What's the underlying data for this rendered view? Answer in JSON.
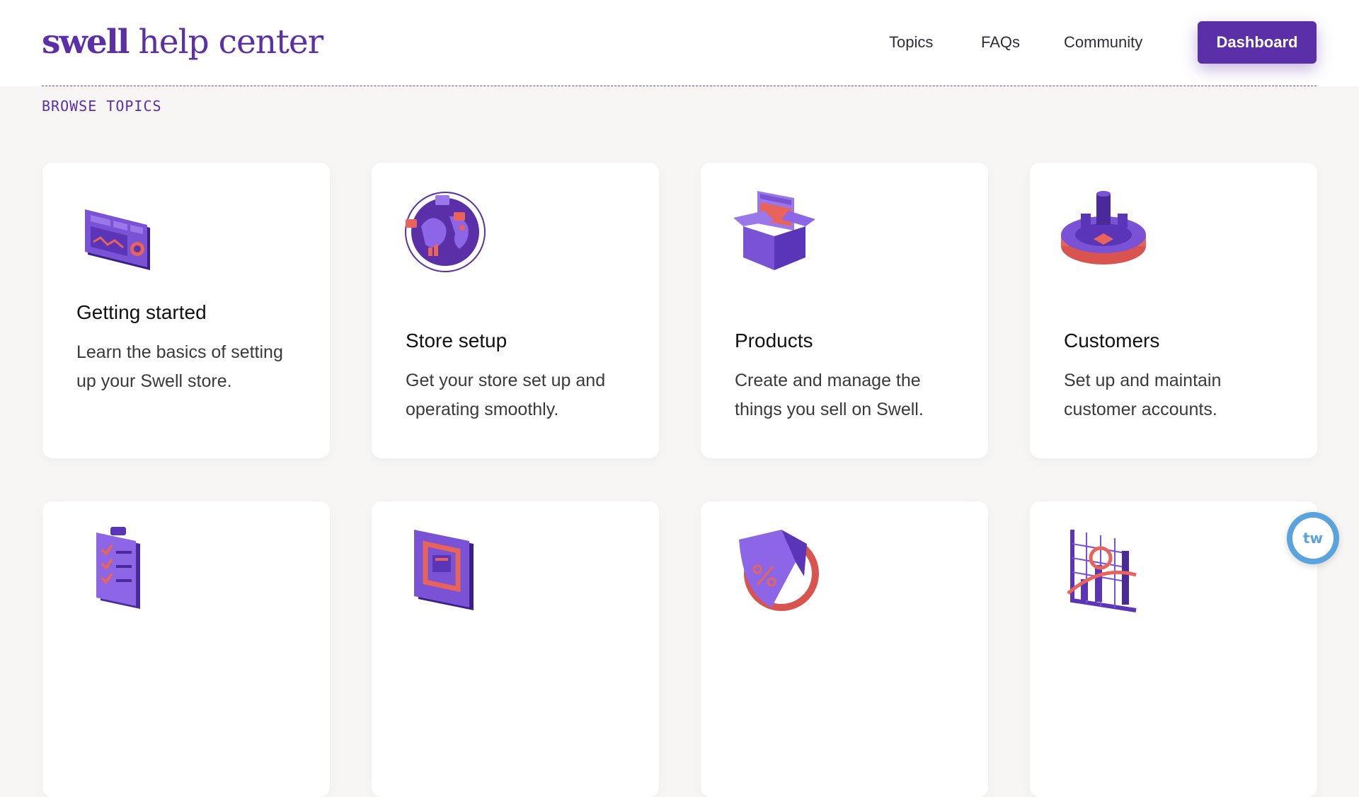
{
  "header": {
    "logo_brand": "swell",
    "logo_rest": " help center",
    "nav": [
      "Topics",
      "FAQs",
      "Community"
    ],
    "dashboard_label": "Dashboard"
  },
  "section_label": "BROWSE TOPICS",
  "cards": [
    {
      "title": "Getting started",
      "desc": "Learn the basics of setting up your Swell store.",
      "icon": "dashboard-screen-icon"
    },
    {
      "title": "Store setup",
      "desc": "Get your store set up and operating smoothly.",
      "icon": "globe-icon"
    },
    {
      "title": "Products",
      "desc": "Create and manage the things you sell on Swell.",
      "icon": "product-box-icon"
    },
    {
      "title": "Customers",
      "desc": "Set up and maintain customer accounts.",
      "icon": "customer-platform-icon"
    },
    {
      "title": "",
      "desc": "",
      "icon": "clipboard-checklist-icon"
    },
    {
      "title": "",
      "desc": "",
      "icon": "sync-window-icon"
    },
    {
      "title": "",
      "desc": "",
      "icon": "discount-tag-icon"
    },
    {
      "title": "",
      "desc": "",
      "icon": "analytics-chart-icon"
    }
  ],
  "chat_widget": {
    "label": "tw"
  },
  "colors": {
    "brand": "#5b2fa8",
    "accent": "#e8635a",
    "background": "#f7f6f5"
  }
}
